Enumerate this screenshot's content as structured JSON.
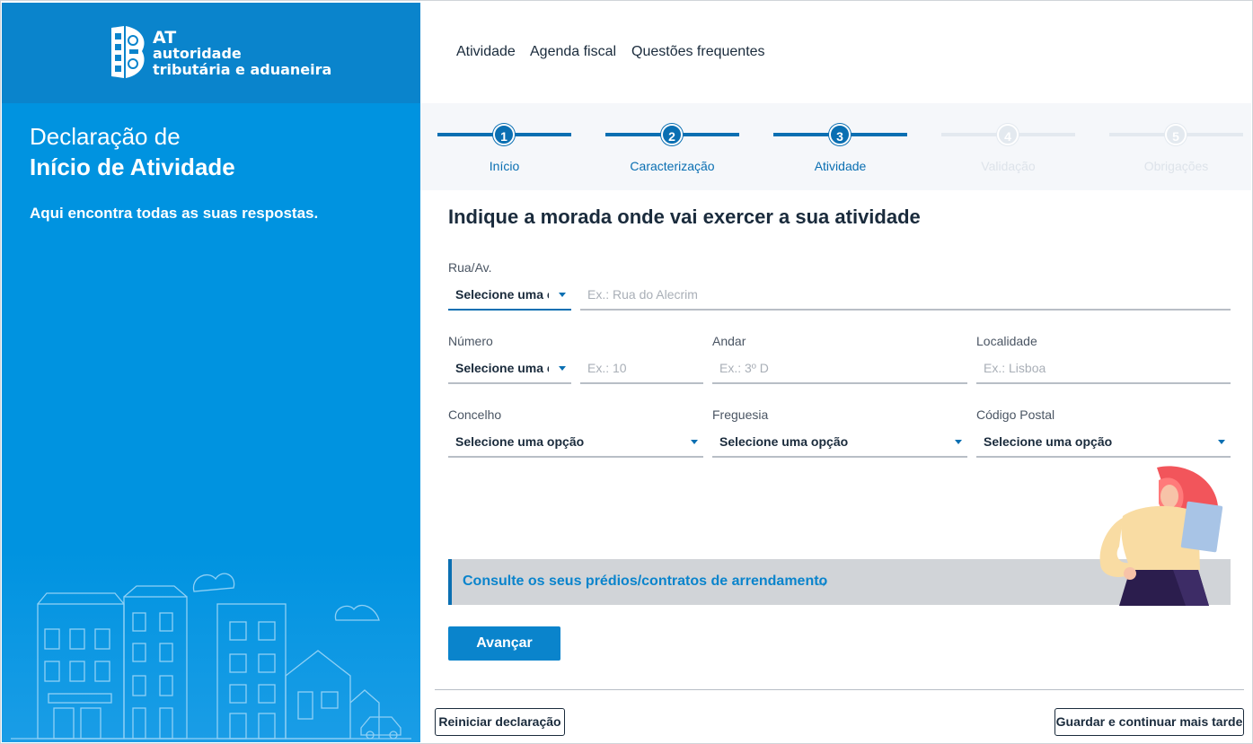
{
  "brand": {
    "mark": "AT",
    "line1": "autoridade",
    "line2": "tributária e aduaneira"
  },
  "sidebar": {
    "title_light": "Declaração de",
    "title_bold": "Início de Atividade",
    "subtitle": "Aqui encontra todas as suas respostas."
  },
  "nav": [
    "Atividade",
    "Agenda fiscal",
    "Questões frequentes"
  ],
  "steps": [
    {
      "num": "1",
      "label": "Início",
      "state": "done"
    },
    {
      "num": "2",
      "label": "Caracterização",
      "state": "done"
    },
    {
      "num": "3",
      "label": "Atividade",
      "state": "current"
    },
    {
      "num": "4",
      "label": "Validação",
      "state": "pending"
    },
    {
      "num": "5",
      "label": "Obrigações",
      "state": "pending"
    }
  ],
  "form": {
    "heading": "Indique a morada onde vai exercer a sua atividade",
    "rua_label": "Rua/Av.",
    "rua_select": "Selecione uma c",
    "rua_placeholder": "Ex.: Rua do Alecrim",
    "numero_label": "Número",
    "numero_select": "Selecione uma c",
    "numero_placeholder": "Ex.: 10",
    "andar_label": "Andar",
    "andar_placeholder": "Ex.: 3º D",
    "localidade_label": "Localidade",
    "localidade_placeholder": "Ex.: Lisboa",
    "concelho_label": "Concelho",
    "concelho_value": "Selecione uma opção",
    "freguesia_label": "Freguesia",
    "freguesia_value": "Selecione uma opção",
    "codigo_label": "Código Postal",
    "codigo_value": "Selecione uma opção"
  },
  "banner": {
    "text": "Consulte os seus prédios/contratos de arrendamento",
    "arrow": "→"
  },
  "actions": {
    "next": "Avançar",
    "restart": "Reiniciar declaração",
    "save": "Guardar e continuar mais tarde"
  },
  "colors": {
    "sidebar": "#0093e0",
    "sidebar_header": "#0a84cc",
    "accent": "#0a6fb2"
  }
}
